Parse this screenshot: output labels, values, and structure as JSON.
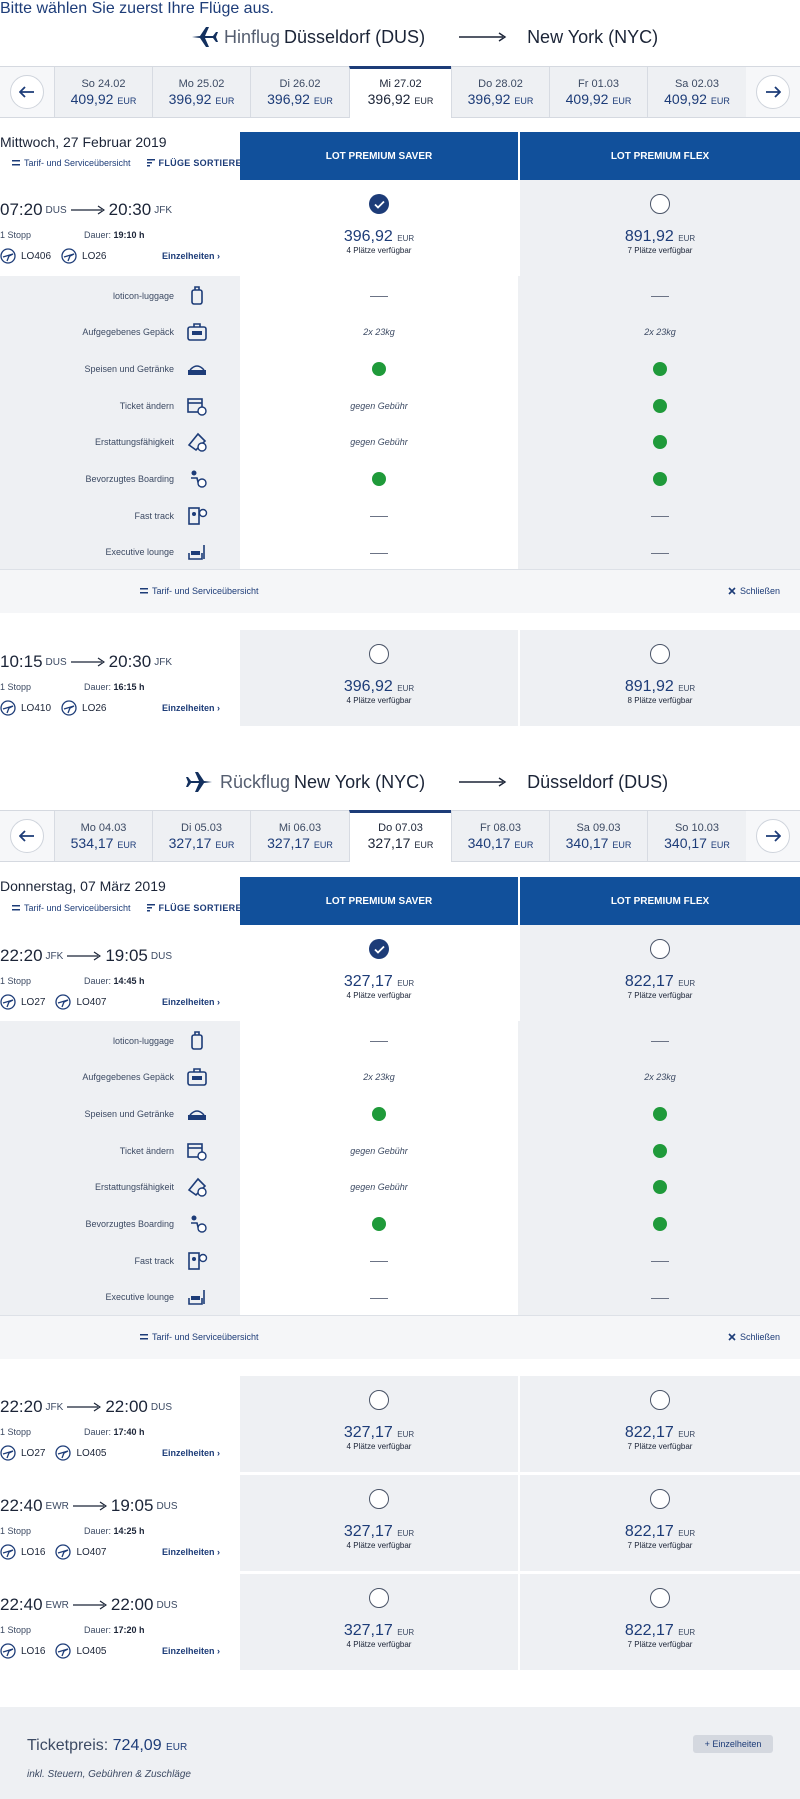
{
  "header": {
    "title": "Bitte wählen Sie zuerst Ihre Flüge aus."
  },
  "outbound": {
    "label": "Hinflug",
    "from": "Düsseldorf (DUS)",
    "to": "New York (NYC)",
    "dates": [
      {
        "label": "So 24.02",
        "price": "409,92",
        "cur": "EUR"
      },
      {
        "label": "Mo 25.02",
        "price": "396,92",
        "cur": "EUR"
      },
      {
        "label": "Di 26.02",
        "price": "396,92",
        "cur": "EUR"
      },
      {
        "label": "Mi 27.02",
        "price": "396,92",
        "cur": "EUR"
      },
      {
        "label": "Do 28.02",
        "price": "396,92",
        "cur": "EUR"
      },
      {
        "label": "Fr 01.03",
        "price": "409,92",
        "cur": "EUR"
      },
      {
        "label": "Sa 02.03",
        "price": "409,92",
        "cur": "EUR"
      }
    ],
    "day_title": "Mittwoch, 27 Februar 2019",
    "flights": [
      {
        "dep": "07:20",
        "dep_ap": "DUS",
        "arr": "20:30",
        "arr_ap": "JFK",
        "stops": "1 Stopp",
        "dur_label": "Dauer:",
        "dur": "19:10 h",
        "c1": "LO406",
        "c2": "LO26",
        "saver_price": "396,92",
        "saver_seats": "4 Plätze verfügbar",
        "flex_price": "891,92",
        "flex_seats": "7 Plätze verfügbar"
      },
      {
        "dep": "10:15",
        "dep_ap": "DUS",
        "arr": "20:30",
        "arr_ap": "JFK",
        "stops": "1 Stopp",
        "dur_label": "Dauer:",
        "dur": "16:15 h",
        "c1": "LO410",
        "c2": "LO26",
        "saver_price": "396,92",
        "saver_seats": "4 Plätze verfügbar",
        "flex_price": "891,92",
        "flex_seats": "8 Plätze verfügbar"
      }
    ]
  },
  "inbound": {
    "label": "Rückflug",
    "from": "New York (NYC)",
    "to": "Düsseldorf (DUS)",
    "dates": [
      {
        "label": "Mo 04.03",
        "price": "534,17",
        "cur": "EUR"
      },
      {
        "label": "Di 05.03",
        "price": "327,17",
        "cur": "EUR"
      },
      {
        "label": "Mi 06.03",
        "price": "327,17",
        "cur": "EUR"
      },
      {
        "label": "Do 07.03",
        "price": "327,17",
        "cur": "EUR"
      },
      {
        "label": "Fr 08.03",
        "price": "340,17",
        "cur": "EUR"
      },
      {
        "label": "Sa 09.03",
        "price": "340,17",
        "cur": "EUR"
      },
      {
        "label": "So 10.03",
        "price": "340,17",
        "cur": "EUR"
      }
    ],
    "day_title": "Donnerstag, 07 März 2019",
    "flights": [
      {
        "dep": "22:20",
        "dep_ap": "JFK",
        "arr": "19:05",
        "arr_ap": "DUS",
        "stops": "1 Stopp",
        "dur_label": "Dauer:",
        "dur": "14:45 h",
        "c1": "LO27",
        "c2": "LO407",
        "saver_price": "327,17",
        "saver_seats": "4 Plätze verfügbar",
        "flex_price": "822,17",
        "flex_seats": "7 Plätze verfügbar"
      },
      {
        "dep": "22:20",
        "dep_ap": "JFK",
        "arr": "22:00",
        "arr_ap": "DUS",
        "stops": "1 Stopp",
        "dur_label": "Dauer:",
        "dur": "17:40 h",
        "c1": "LO27",
        "c2": "LO405",
        "saver_price": "327,17",
        "saver_seats": "4 Plätze verfügbar",
        "flex_price": "822,17",
        "flex_seats": "7 Plätze verfügbar"
      },
      {
        "dep": "22:40",
        "dep_ap": "EWR",
        "arr": "19:05",
        "arr_ap": "DUS",
        "stops": "1 Stopp",
        "dur_label": "Dauer:",
        "dur": "14:25 h",
        "c1": "LO16",
        "c2": "LO407",
        "saver_price": "327,17",
        "saver_seats": "4 Plätze verfügbar",
        "flex_price": "822,17",
        "flex_seats": "7 Plätze verfügbar"
      },
      {
        "dep": "22:40",
        "dep_ap": "EWR",
        "arr": "22:00",
        "arr_ap": "DUS",
        "stops": "1 Stopp",
        "dur_label": "Dauer:",
        "dur": "17:20 h",
        "c1": "LO16",
        "c2": "LO405",
        "saver_price": "327,17",
        "saver_seats": "4 Plätze verfügbar",
        "flex_price": "822,17",
        "flex_seats": "7 Plätze verfügbar"
      }
    ]
  },
  "common": {
    "tarif_link": "Tarif- und Serviceübersicht",
    "sort_link": "FLÜGE SORTIEREN",
    "saver_head": "LOT PREMIUM SAVER",
    "flex_head": "LOT PREMIUM FLEX",
    "details": "Einzelheiten",
    "cur": "EUR",
    "close": "Schließen",
    "services": [
      {
        "label": "loticon-luggage",
        "icon": "luggage-icon",
        "saver": "dash",
        "flex": "dash"
      },
      {
        "label": "Aufgegebenes Gepäck",
        "icon": "checked-bag-icon",
        "saver": "2x 23kg",
        "flex": "2x 23kg"
      },
      {
        "label": "Speisen und Getränke",
        "icon": "meal-icon",
        "saver": "check",
        "flex": "check"
      },
      {
        "label": "Ticket ändern",
        "icon": "calendar-change-icon",
        "saver": "gegen Gebühr",
        "flex": "check"
      },
      {
        "label": "Erstattungsfähigkeit",
        "icon": "refund-ticket-icon",
        "saver": "gegen Gebühr",
        "flex": "check"
      },
      {
        "label": "Bevorzugtes Boarding",
        "icon": "priority-boarding-icon",
        "saver": "check",
        "flex": "check"
      },
      {
        "label": "Fast track",
        "icon": "fast-track-icon",
        "saver": "dash",
        "flex": "dash"
      },
      {
        "label": "Executive lounge",
        "icon": "lounge-icon",
        "saver": "dash",
        "flex": "dash"
      }
    ]
  },
  "total": {
    "label": "Ticketpreis:",
    "price": "724,09",
    "cur": "EUR",
    "note": "inkl. Steuern, Gebühren & Zuschläge",
    "details_btn": "+ Einzelheiten"
  },
  "colors": {
    "brand": "#11509b",
    "navy": "#1d3c78",
    "check_green": "#1f9a3a",
    "panel_grey": "#eef0f3"
  }
}
